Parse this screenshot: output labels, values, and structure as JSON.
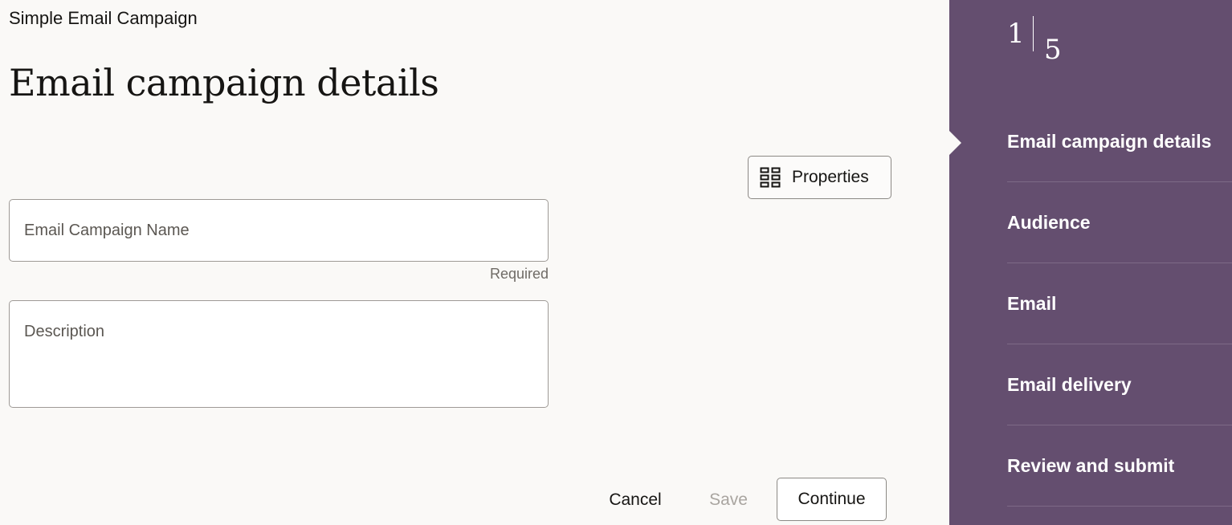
{
  "header": {
    "app_title": "Simple Email Campaign",
    "page_title": "Email campaign details"
  },
  "toolbar": {
    "properties_label": "Properties",
    "properties_icon": "grid-icon"
  },
  "form": {
    "name_field": {
      "placeholder": "Email Campaign Name",
      "value": "",
      "helper": "Required"
    },
    "description_field": {
      "placeholder": "Description",
      "value": ""
    }
  },
  "actions": {
    "cancel_label": "Cancel",
    "save_label": "Save",
    "continue_label": "Continue"
  },
  "train": {
    "current_step": "1",
    "total_steps": "5",
    "steps": [
      {
        "label": "Email campaign details"
      },
      {
        "label": "Audience"
      },
      {
        "label": "Email"
      },
      {
        "label": "Email delivery"
      },
      {
        "label": "Review and submit"
      }
    ]
  },
  "colors": {
    "train_background": "#644e6f",
    "page_background": "#faf9f7"
  }
}
